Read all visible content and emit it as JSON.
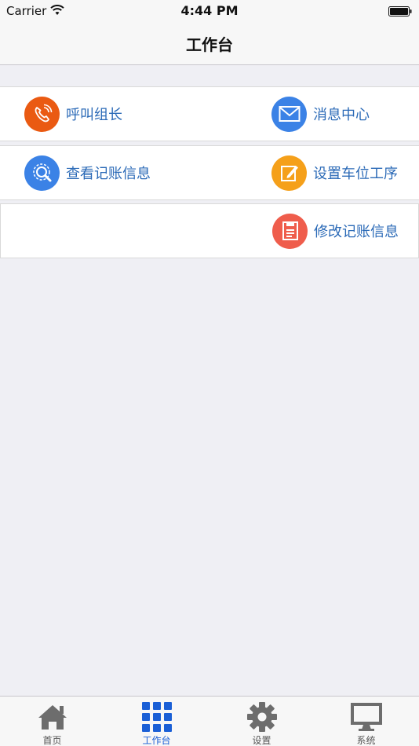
{
  "status_bar": {
    "carrier": "Carrier",
    "time": "4:44 PM"
  },
  "nav": {
    "title": "工作台"
  },
  "grid": {
    "call_leader": "呼叫组长",
    "message_center": "消息中心",
    "view_accounting": "查看记账信息",
    "set_station_process": "设置车位工序",
    "edit_accounting": "修改记账信息"
  },
  "colors": {
    "call_leader": "#ea5a12",
    "message_center": "#3b82e6",
    "view_accounting": "#3b82e6",
    "set_station_process": "#f5a01a",
    "edit_accounting": "#ef5d4c",
    "label": "#2b6ab7",
    "tab_active": "#1a5fd6"
  },
  "tabs": [
    {
      "label": "首页",
      "icon": "home-icon"
    },
    {
      "label": "工作台",
      "icon": "grid-icon"
    },
    {
      "label": "设置",
      "icon": "gear-icon"
    },
    {
      "label": "系统",
      "icon": "monitor-icon"
    }
  ]
}
